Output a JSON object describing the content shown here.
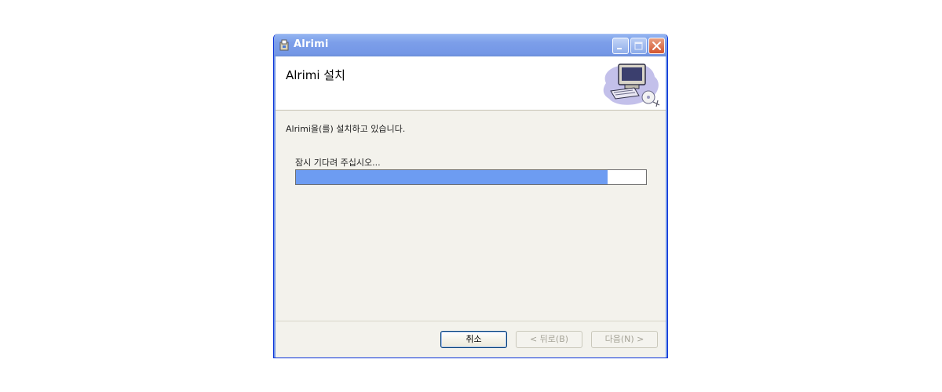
{
  "window": {
    "title": "Alrimi",
    "title_icon": "installer-package-icon"
  },
  "header": {
    "title": "Alrimi 설치",
    "graphic": "computer-setup-icon"
  },
  "body": {
    "status": "Alrimi을(를) 설치하고 있습니다.",
    "wait_message": "잠시 기다려 주십시오...",
    "progress_percent": 89
  },
  "buttons": {
    "cancel": "취소",
    "back": "< 뒤로(B)",
    "next": "다음(N) >"
  },
  "colors": {
    "titlebar": "#7497e6",
    "progress_fill": "#6d9cf2",
    "close_button": "#d3552f"
  }
}
